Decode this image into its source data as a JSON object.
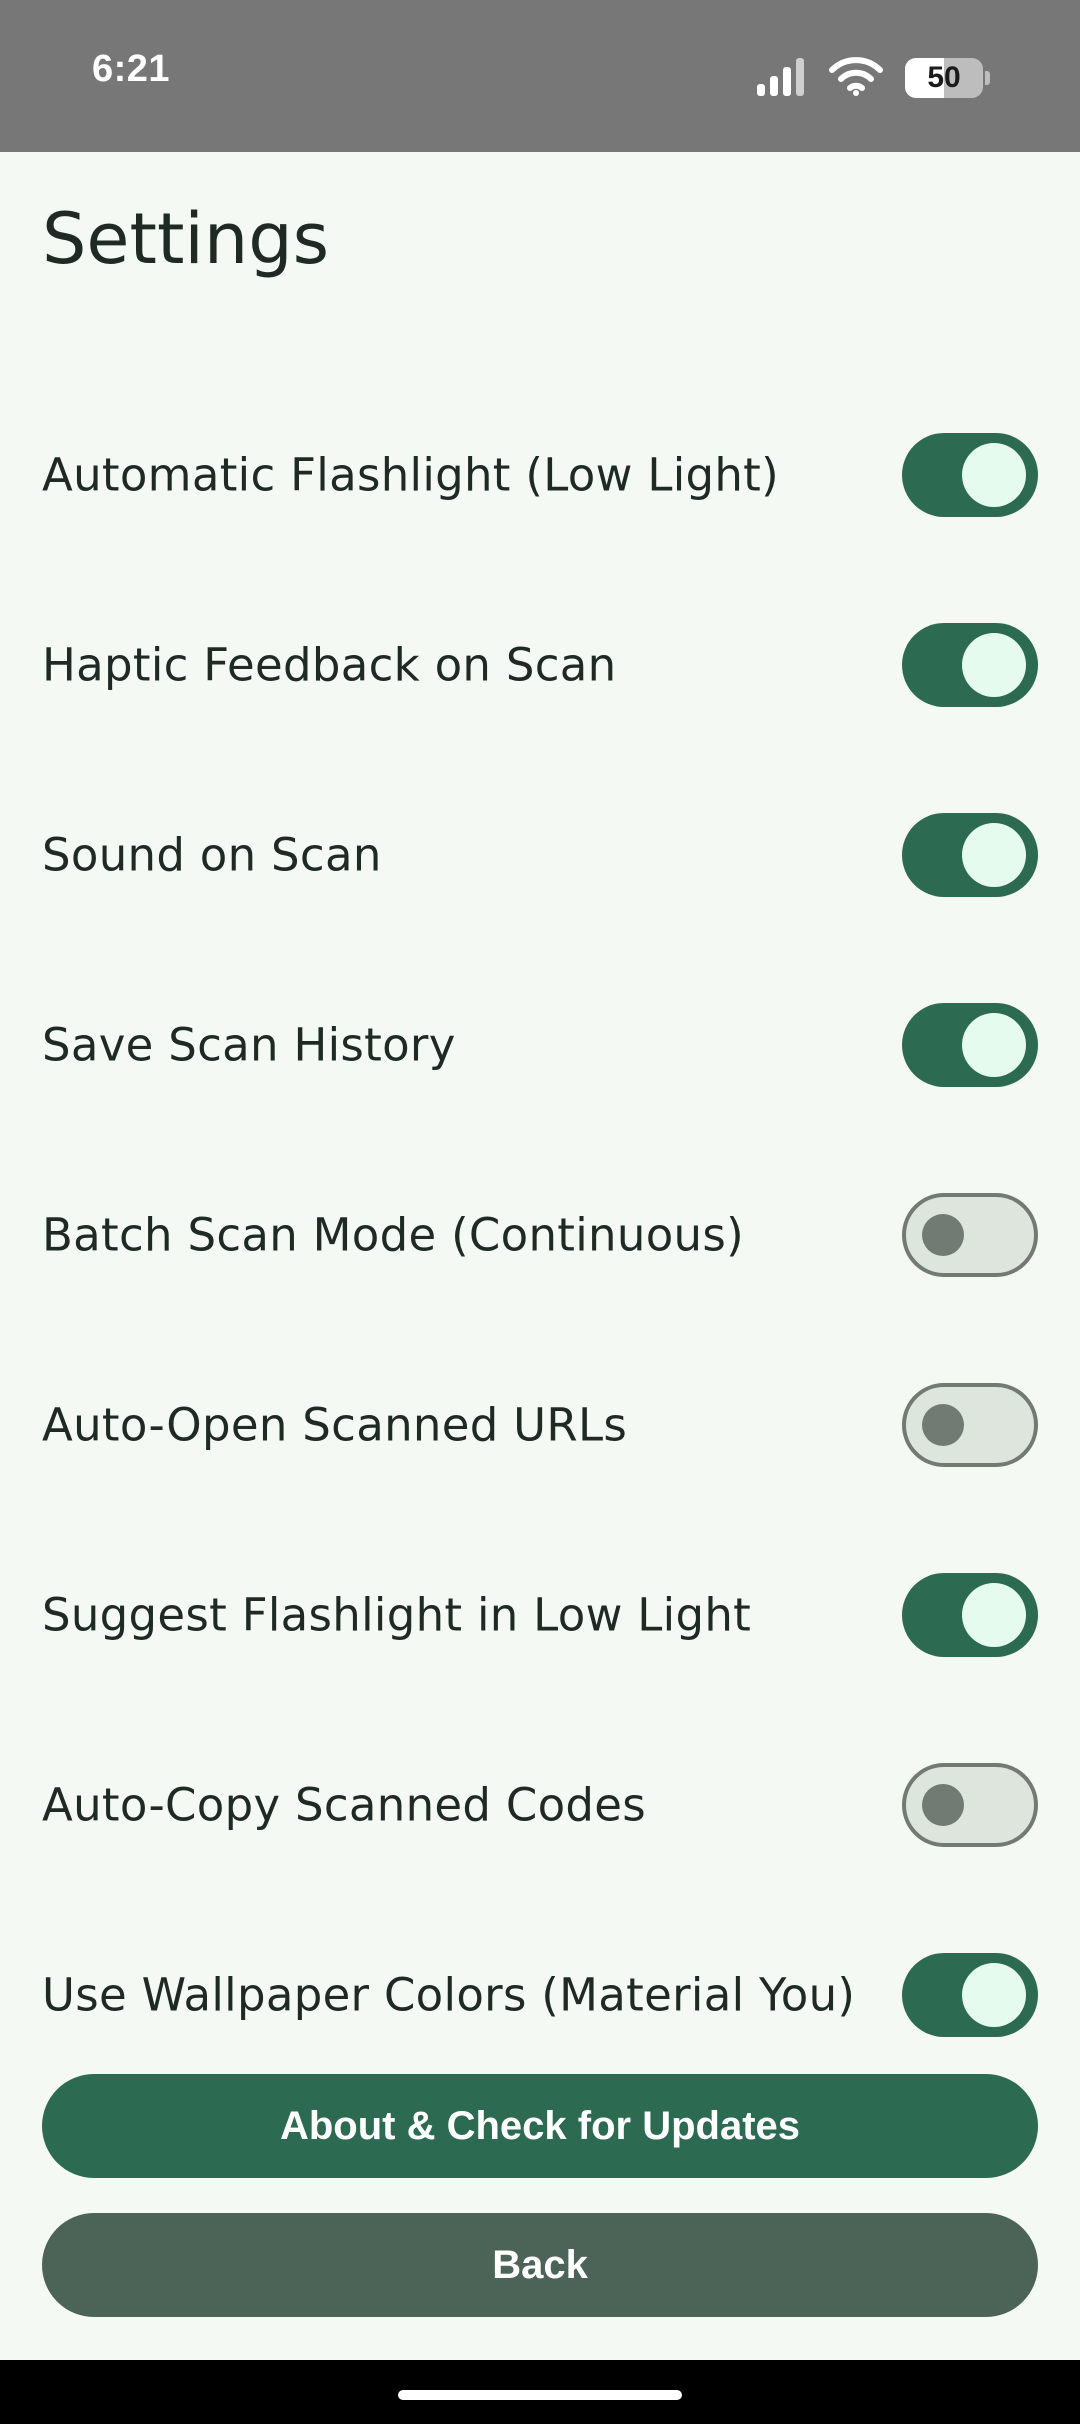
{
  "status_bar": {
    "time": "6:21",
    "battery_level": "50",
    "battery_fraction": 0.5
  },
  "page": {
    "title": "Settings"
  },
  "settings": [
    {
      "key": "auto-flashlight",
      "label": "Automatic Flashlight (Low Light)",
      "enabled": true
    },
    {
      "key": "haptic-feedback",
      "label": "Haptic Feedback on Scan",
      "enabled": true
    },
    {
      "key": "sound-on-scan",
      "label": "Sound on Scan",
      "enabled": true
    },
    {
      "key": "save-history",
      "label": "Save Scan History",
      "enabled": true
    },
    {
      "key": "batch-scan",
      "label": "Batch Scan Mode (Continuous)",
      "enabled": false
    },
    {
      "key": "auto-open-urls",
      "label": "Auto-Open Scanned URLs",
      "enabled": false
    },
    {
      "key": "suggest-flashlight",
      "label": "Suggest Flashlight in Low Light",
      "enabled": true
    },
    {
      "key": "auto-copy",
      "label": "Auto-Copy Scanned Codes",
      "enabled": false
    },
    {
      "key": "wallpaper-colors",
      "label": "Use Wallpaper Colors (Material You)",
      "enabled": true
    }
  ],
  "buttons": {
    "about_label": "About & Check for Updates",
    "back_label": "Back"
  },
  "colors": {
    "accent": "#2c6a52",
    "secondary": "#4c6358",
    "background": "#f4f9f4",
    "status_bar": "#777777"
  },
  "icons": {
    "signal": "signal-icon",
    "wifi": "wifi-icon",
    "battery": "battery-icon"
  }
}
